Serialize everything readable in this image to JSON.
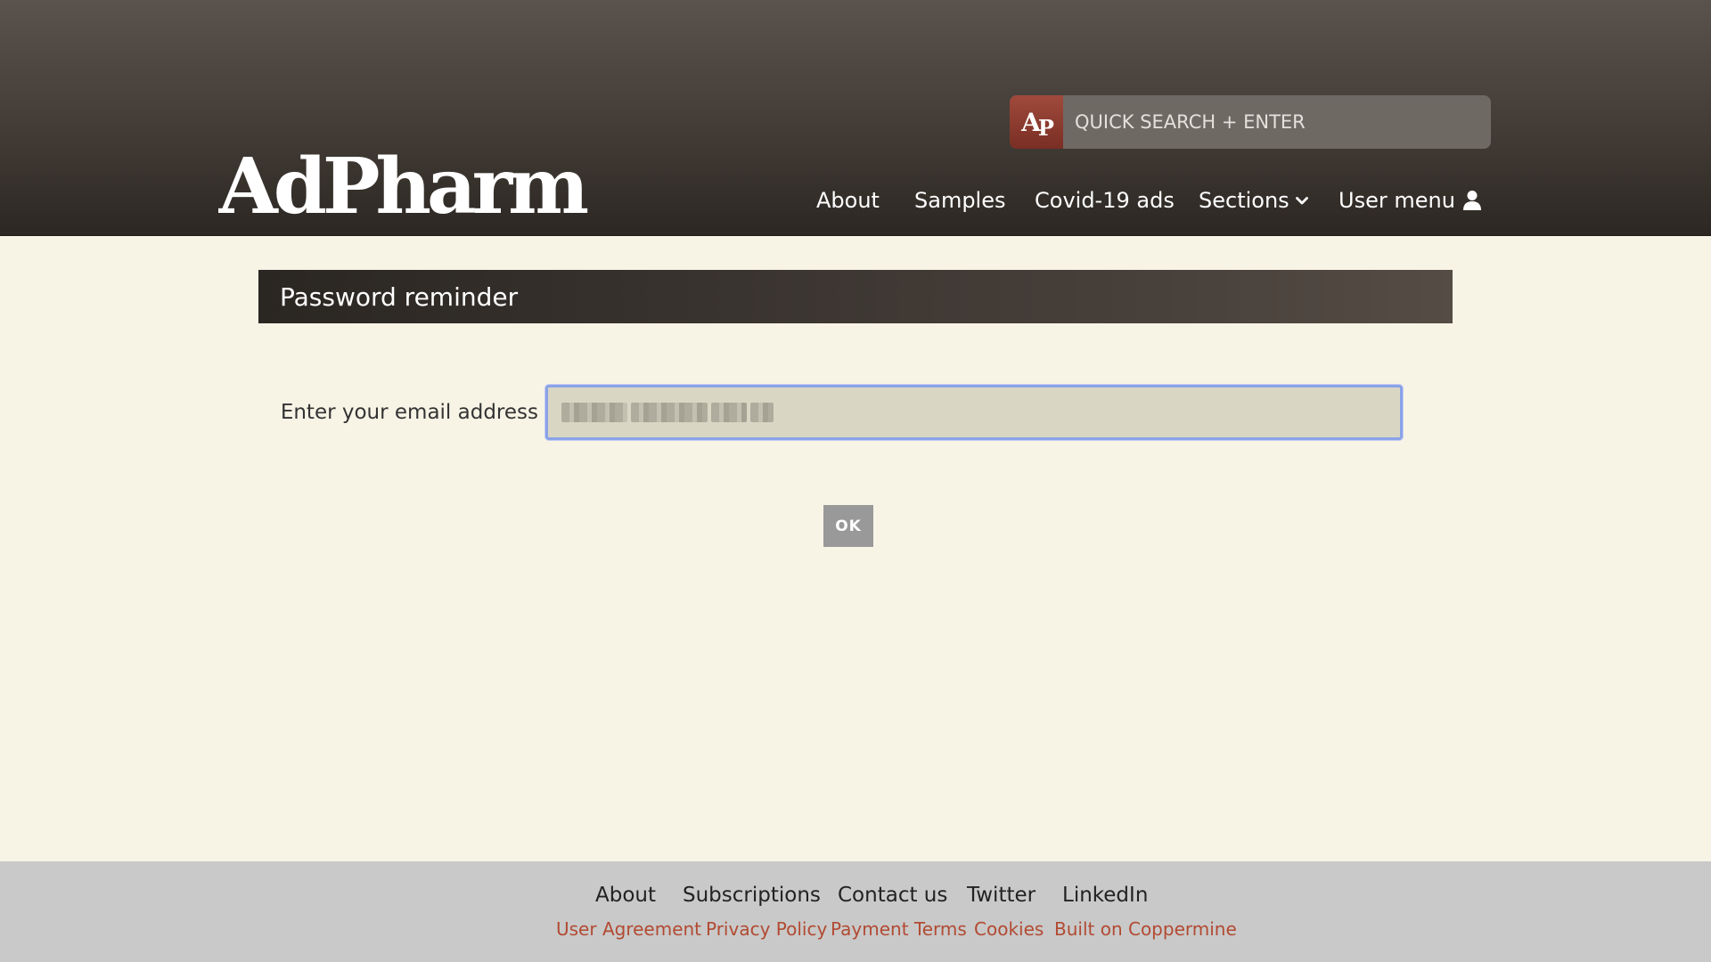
{
  "header": {
    "logo_text": "AdPharm",
    "search": {
      "logo_text_a": "A",
      "logo_text_p": "P",
      "placeholder": "QUICK SEARCH + ENTER"
    },
    "nav": {
      "about": "About",
      "samples": "Samples",
      "covid": "Covid-19 ads",
      "sections": "Sections",
      "user_menu": "User menu"
    }
  },
  "main": {
    "title": "Password reminder",
    "email_label": "Enter your email address",
    "email_value": "",
    "ok_label": "OK"
  },
  "footer": {
    "primary_links": [
      "About",
      "Subscriptions",
      "Contact us",
      "Twitter",
      "LinkedIn"
    ],
    "secondary_links": [
      "User Agreement",
      "Privacy Policy",
      "Payment Terms",
      "Cookies",
      "Built on Coppermine"
    ]
  },
  "colors": {
    "page_bg": "#f7f4e6",
    "header_dark": "#2c2723",
    "accent_red": "#b24a32",
    "footer_bg": "#c9c9c9",
    "input_focus": "#8aa2e8"
  }
}
